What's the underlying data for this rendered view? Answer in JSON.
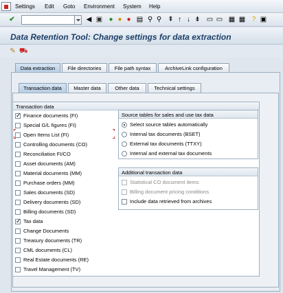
{
  "menubar": {
    "items": [
      "Settings",
      "Edit",
      "Goto",
      "Environment",
      "System",
      "Help"
    ]
  },
  "toolbar": {
    "command_value": ""
  },
  "title": "Data Retention Tool: Change settings for data extraction",
  "main_tabs": [
    "Data extraction",
    "File directories",
    "File path syntax",
    "ArchiveLink configuration"
  ],
  "sub_tabs": [
    "Transaction data",
    "Master data",
    "Other data",
    "Technical settings"
  ],
  "transaction_frame": {
    "title": "Transaction data",
    "items": [
      {
        "label": "Finance documents (FI)",
        "checked": true
      },
      {
        "label": "Special G/L figures (FI)",
        "checked": false
      },
      {
        "label": "Open Items List (FI)",
        "checked": false
      },
      {
        "label": "Controlling documents (CO)",
        "checked": false
      },
      {
        "label": "Reconciliation FI/CO",
        "checked": false
      },
      {
        "label": "Asset documents (AM)",
        "checked": false
      },
      {
        "label": "Material documents (MM)",
        "checked": false
      },
      {
        "label": "Purchase orders (MM)",
        "checked": false
      },
      {
        "label": "Sales documents (SD)",
        "checked": false
      },
      {
        "label": "Delivery documents (SD)",
        "checked": false
      },
      {
        "label": "Billing documents (SD)",
        "checked": false
      },
      {
        "label": "Tax data",
        "checked": true
      },
      {
        "label": "Change Documents",
        "checked": false
      },
      {
        "label": "Treasury documents (TR)",
        "checked": false
      },
      {
        "label": "CML documents (CL)",
        "checked": false
      },
      {
        "label": "Real Estate documents (RE)",
        "checked": false
      },
      {
        "label": "Travel Management (TV)",
        "checked": false
      }
    ]
  },
  "source_frame": {
    "title": "Source tables for sales and use tax data",
    "options": [
      {
        "label": "Select source tables automatically",
        "selected": true
      },
      {
        "label": "Internal tax documents (BSET)",
        "selected": false
      },
      {
        "label": "External tax documents (TTXY)",
        "selected": false
      },
      {
        "label": "Internal and external tax documents",
        "selected": false
      }
    ]
  },
  "additional_frame": {
    "title": "Additional transaction data",
    "items": [
      {
        "label": "Statistical CO document items",
        "checked": false,
        "disabled": true
      },
      {
        "label": "Billing document pricing conditions",
        "checked": false,
        "disabled": true
      },
      {
        "label": "Include data retrieved from archives",
        "checked": false,
        "disabled": false
      }
    ]
  }
}
